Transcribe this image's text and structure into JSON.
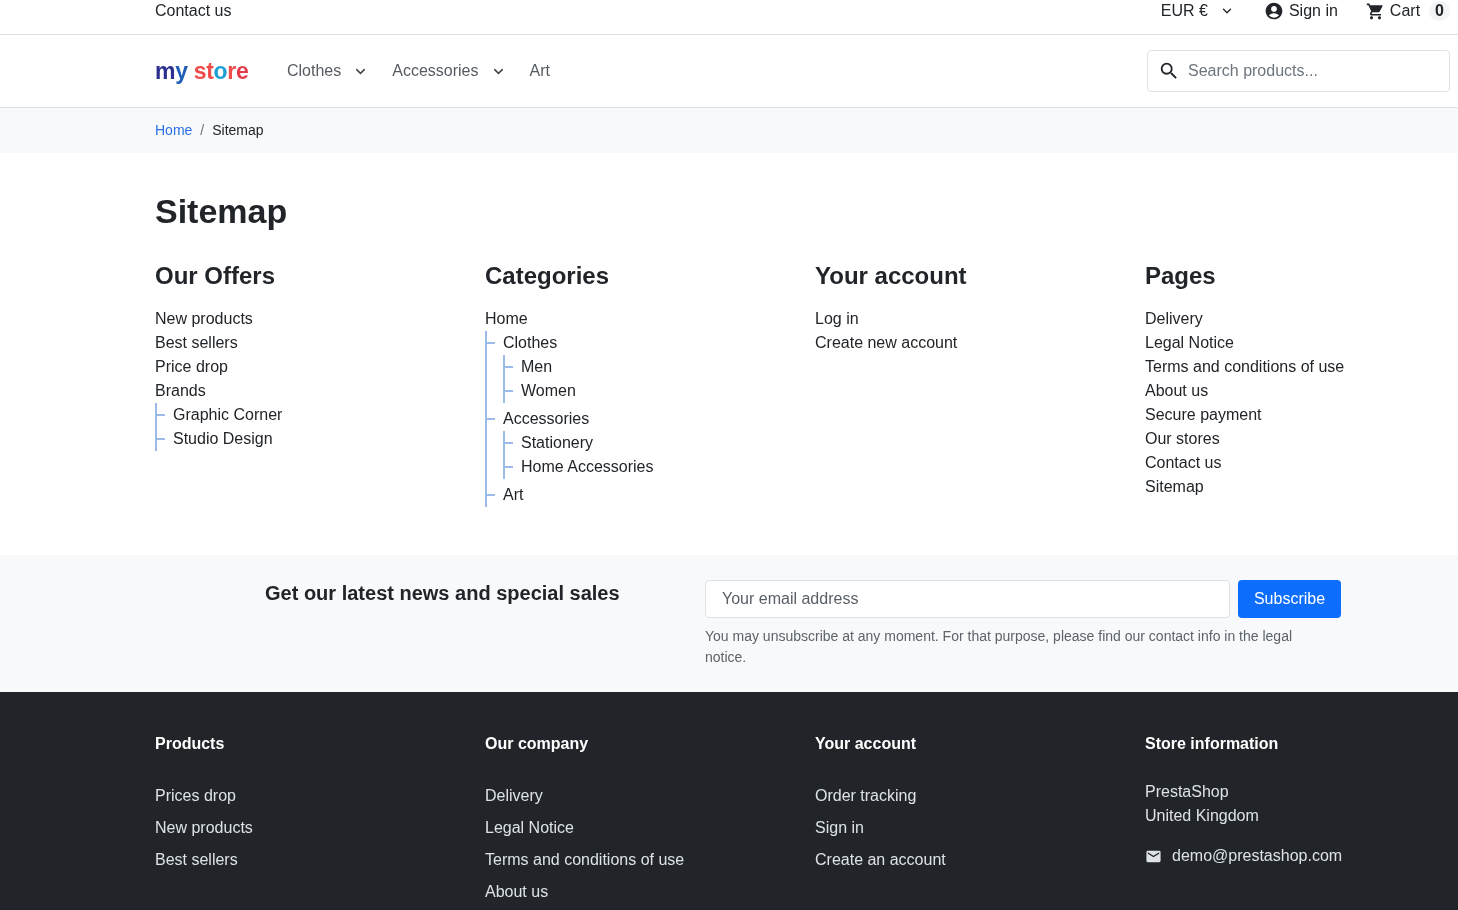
{
  "top_bar": {
    "contact_link": "Contact us",
    "currency": "EUR €",
    "sign_in": "Sign in",
    "cart_label": "Cart",
    "cart_count": "0"
  },
  "header": {
    "logo": "my store",
    "nav": [
      {
        "label": "Clothes",
        "has_menu": true
      },
      {
        "label": "Accessories",
        "has_menu": true
      },
      {
        "label": "Art",
        "has_menu": false
      }
    ],
    "search": {
      "placeholder": "Search products..."
    }
  },
  "breadcrumb": {
    "separator": "/",
    "items": [
      {
        "label": "Home",
        "current": false
      },
      {
        "label": "Sitemap",
        "current": true
      }
    ]
  },
  "page_title": "Sitemap",
  "sitemap": [
    {
      "title": "Our Offers",
      "items": [
        {
          "label": "New products"
        },
        {
          "label": "Best sellers"
        },
        {
          "label": "Price drop"
        },
        {
          "label": "Brands",
          "children": [
            {
              "label": "Graphic Corner"
            },
            {
              "label": "Studio Design"
            }
          ]
        }
      ]
    },
    {
      "title": "Categories",
      "items": [
        {
          "label": "Home",
          "children": [
            {
              "label": "Clothes",
              "children": [
                {
                  "label": "Men"
                },
                {
                  "label": "Women"
                }
              ]
            },
            {
              "label": "Accessories",
              "children": [
                {
                  "label": "Stationery"
                },
                {
                  "label": "Home Accessories"
                }
              ]
            },
            {
              "label": "Art"
            }
          ]
        }
      ]
    },
    {
      "title": "Your account",
      "items": [
        {
          "label": "Log in"
        },
        {
          "label": "Create new account"
        }
      ]
    },
    {
      "title": "Pages",
      "items": [
        {
          "label": "Delivery"
        },
        {
          "label": "Legal Notice"
        },
        {
          "label": "Terms and conditions of use"
        },
        {
          "label": "About us"
        },
        {
          "label": "Secure payment"
        },
        {
          "label": "Our stores"
        },
        {
          "label": "Contact us"
        },
        {
          "label": "Sitemap"
        }
      ]
    }
  ],
  "newsletter": {
    "title": "Get our latest news and special sales",
    "email_placeholder": "Your email address",
    "button": "Subscribe",
    "note": "You may unsubscribe at any moment. For that purpose, please find our contact info in the legal notice."
  },
  "footer": {
    "columns": [
      {
        "title": "Products",
        "links": [
          "Prices drop",
          "New products",
          "Best sellers"
        ]
      },
      {
        "title": "Our company",
        "links": [
          "Delivery",
          "Legal Notice",
          "Terms and conditions of use",
          "About us"
        ]
      },
      {
        "title": "Your account",
        "links": [
          "Order tracking",
          "Sign in",
          "Create an account"
        ]
      }
    ],
    "store_info": {
      "title": "Store information",
      "lines": [
        "PrestaShop",
        "United Kingdom"
      ],
      "email": "demo@prestashop.com"
    }
  }
}
